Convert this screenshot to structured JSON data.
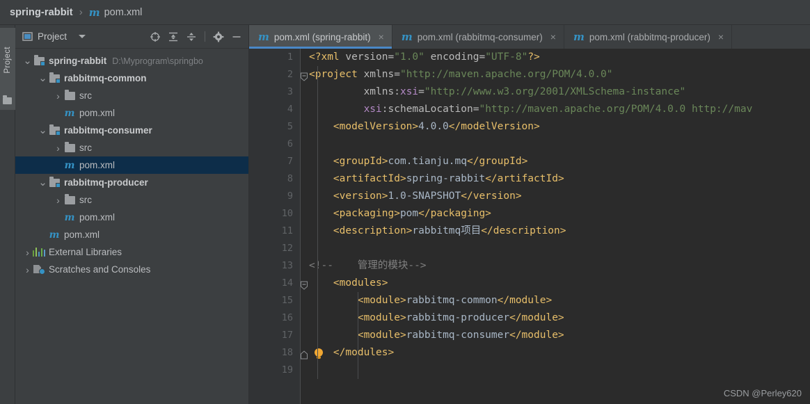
{
  "window": {
    "theme_bg": "#3c3f41",
    "editor_bg": "#2b2b2b",
    "accent": "#4a88c7",
    "selection_bg": "#0d2d49"
  },
  "breadcrumb": {
    "root": "spring-rabbit",
    "separator": "›",
    "file_icon": "m",
    "file": "pom.xml"
  },
  "tool_strip": {
    "project_tab_label": "Project",
    "folder_icon": "folder-icon"
  },
  "project_panel": {
    "title": "Project",
    "view_icon": "project-view-icon",
    "dropdown_icon": "chevron-down-icon",
    "toolbar_buttons": [
      {
        "name": "select-opened-file-icon",
        "label": "Select Opened File"
      },
      {
        "name": "expand-all-icon",
        "label": "Expand All"
      },
      {
        "name": "collapse-all-icon",
        "label": "Collapse All"
      },
      {
        "name": "gear-icon",
        "label": "Settings"
      },
      {
        "name": "hide-icon",
        "label": "Hide"
      }
    ],
    "tree": [
      {
        "label": "spring-rabbit",
        "path": "D:\\Myprogram\\springbo",
        "icon": "module-folder-icon",
        "arrow": "expanded",
        "indent": 0,
        "bold": true,
        "selected": false
      },
      {
        "label": "rabbitmq-common",
        "path": "",
        "icon": "module-folder-icon",
        "arrow": "expanded",
        "indent": 1,
        "bold": true,
        "selected": false
      },
      {
        "label": "src",
        "path": "",
        "icon": "folder-icon",
        "arrow": "collapsed",
        "indent": 2,
        "bold": false,
        "selected": false
      },
      {
        "label": "pom.xml",
        "path": "",
        "icon": "maven-file-icon",
        "arrow": "none",
        "indent": 2,
        "bold": false,
        "selected": false
      },
      {
        "label": "rabbitmq-consumer",
        "path": "",
        "icon": "module-folder-icon",
        "arrow": "expanded",
        "indent": 1,
        "bold": true,
        "selected": false
      },
      {
        "label": "src",
        "path": "",
        "icon": "folder-icon",
        "arrow": "collapsed",
        "indent": 2,
        "bold": false,
        "selected": false
      },
      {
        "label": "pom.xml",
        "path": "",
        "icon": "maven-file-icon",
        "arrow": "none",
        "indent": 2,
        "bold": false,
        "selected": true
      },
      {
        "label": "rabbitmq-producer",
        "path": "",
        "icon": "module-folder-icon",
        "arrow": "expanded",
        "indent": 1,
        "bold": true,
        "selected": false
      },
      {
        "label": "src",
        "path": "",
        "icon": "folder-icon",
        "arrow": "collapsed",
        "indent": 2,
        "bold": false,
        "selected": false
      },
      {
        "label": "pom.xml",
        "path": "",
        "icon": "maven-file-icon",
        "arrow": "none",
        "indent": 2,
        "bold": false,
        "selected": false
      },
      {
        "label": "pom.xml",
        "path": "",
        "icon": "maven-file-icon",
        "arrow": "none",
        "indent": 1,
        "bold": false,
        "selected": false
      },
      {
        "label": "External Libraries",
        "path": "",
        "icon": "library-icon",
        "arrow": "collapsed",
        "indent": 0,
        "bold": false,
        "selected": false
      },
      {
        "label": "Scratches and Consoles",
        "path": "",
        "icon": "scratches-icon",
        "arrow": "collapsed",
        "indent": 0,
        "bold": false,
        "selected": false
      }
    ]
  },
  "editor": {
    "tabs": [
      {
        "icon": "m",
        "label": "pom.xml (spring-rabbit)",
        "close": "×",
        "active": true
      },
      {
        "icon": "m",
        "label": "pom.xml (rabbitmq-consumer)",
        "close": "×",
        "active": false
      },
      {
        "icon": "m",
        "label": "pom.xml (rabbitmq-producer)",
        "close": "×",
        "active": false
      }
    ],
    "line_numbers": [
      "1",
      "2",
      "3",
      "4",
      "5",
      "6",
      "7",
      "8",
      "9",
      "10",
      "11",
      "12",
      "13",
      "14",
      "15",
      "16",
      "17",
      "18",
      "19"
    ],
    "lines": [
      {
        "n": 1,
        "fold": "none",
        "bulb": false,
        "tokens": [
          {
            "t": "tag",
            "s": "<?xml "
          },
          {
            "t": "attr",
            "s": "version="
          },
          {
            "t": "val",
            "s": "\"1.0\""
          },
          {
            "t": "attr",
            "s": " encoding="
          },
          {
            "t": "val",
            "s": "\"UTF-8\""
          },
          {
            "t": "tag",
            "s": "?>"
          }
        ]
      },
      {
        "n": 2,
        "fold": "open",
        "bulb": false,
        "tokens": [
          {
            "t": "tag",
            "s": "<project "
          },
          {
            "t": "attr",
            "s": "xmlns="
          },
          {
            "t": "val",
            "s": "\"http://maven.apache.org/POM/4.0.0\""
          }
        ]
      },
      {
        "n": 3,
        "fold": "none",
        "bulb": false,
        "tokens": [
          {
            "t": "txt",
            "s": "         "
          },
          {
            "t": "attr",
            "s": "xmlns:"
          },
          {
            "t": "ns",
            "s": "xsi"
          },
          {
            "t": "attr",
            "s": "="
          },
          {
            "t": "val",
            "s": "\"http://www.w3.org/2001/XMLSchema-instance\""
          }
        ]
      },
      {
        "n": 4,
        "fold": "none",
        "bulb": false,
        "tokens": [
          {
            "t": "txt",
            "s": "         "
          },
          {
            "t": "ns",
            "s": "xsi"
          },
          {
            "t": "attr",
            "s": ":schemaLocation="
          },
          {
            "t": "val",
            "s": "\"http://maven.apache.org/POM/4.0.0 http://mav"
          }
        ]
      },
      {
        "n": 5,
        "fold": "none",
        "bulb": false,
        "tokens": [
          {
            "t": "txt",
            "s": "    "
          },
          {
            "t": "tag",
            "s": "<modelVersion>"
          },
          {
            "t": "txt",
            "s": "4.0.0"
          },
          {
            "t": "tag",
            "s": "</modelVersion>"
          }
        ]
      },
      {
        "n": 6,
        "fold": "none",
        "bulb": false,
        "tokens": []
      },
      {
        "n": 7,
        "fold": "none",
        "bulb": false,
        "tokens": [
          {
            "t": "txt",
            "s": "    "
          },
          {
            "t": "tag",
            "s": "<groupId>"
          },
          {
            "t": "txt",
            "s": "com.tianju.mq"
          },
          {
            "t": "tag",
            "s": "</groupId>"
          }
        ]
      },
      {
        "n": 8,
        "fold": "none",
        "bulb": false,
        "tokens": [
          {
            "t": "txt",
            "s": "    "
          },
          {
            "t": "tag",
            "s": "<artifactId>"
          },
          {
            "t": "txt",
            "s": "spring-rabbit"
          },
          {
            "t": "tag",
            "s": "</artifactId>"
          }
        ]
      },
      {
        "n": 9,
        "fold": "none",
        "bulb": false,
        "tokens": [
          {
            "t": "txt",
            "s": "    "
          },
          {
            "t": "tag",
            "s": "<version>"
          },
          {
            "t": "txt",
            "s": "1.0-SNAPSHOT"
          },
          {
            "t": "tag",
            "s": "</version>"
          }
        ]
      },
      {
        "n": 10,
        "fold": "none",
        "bulb": false,
        "tokens": [
          {
            "t": "txt",
            "s": "    "
          },
          {
            "t": "tag",
            "s": "<packaging>"
          },
          {
            "t": "txt",
            "s": "pom"
          },
          {
            "t": "tag",
            "s": "</packaging>"
          }
        ]
      },
      {
        "n": 11,
        "fold": "none",
        "bulb": false,
        "tokens": [
          {
            "t": "txt",
            "s": "    "
          },
          {
            "t": "tag",
            "s": "<description>"
          },
          {
            "t": "txt",
            "s": "rabbitmq项目"
          },
          {
            "t": "tag",
            "s": "</description>"
          }
        ]
      },
      {
        "n": 12,
        "fold": "none",
        "bulb": false,
        "tokens": []
      },
      {
        "n": 13,
        "fold": "none",
        "bulb": false,
        "tokens": [
          {
            "t": "cmt",
            "s": "<!--    管理的模块-->"
          }
        ]
      },
      {
        "n": 14,
        "fold": "open",
        "bulb": false,
        "tokens": [
          {
            "t": "txt",
            "s": "    "
          },
          {
            "t": "tag",
            "s": "<modules>"
          }
        ]
      },
      {
        "n": 15,
        "fold": "none",
        "bulb": false,
        "tokens": [
          {
            "t": "txt",
            "s": "        "
          },
          {
            "t": "tag",
            "s": "<module>"
          },
          {
            "t": "txt",
            "s": "rabbitmq-common"
          },
          {
            "t": "tag",
            "s": "</module>"
          }
        ]
      },
      {
        "n": 16,
        "fold": "none",
        "bulb": false,
        "tokens": [
          {
            "t": "txt",
            "s": "        "
          },
          {
            "t": "tag",
            "s": "<module>"
          },
          {
            "t": "txt",
            "s": "rabbitmq-producer"
          },
          {
            "t": "tag",
            "s": "</module>"
          }
        ]
      },
      {
        "n": 17,
        "fold": "none",
        "bulb": false,
        "tokens": [
          {
            "t": "txt",
            "s": "        "
          },
          {
            "t": "tag",
            "s": "<module>"
          },
          {
            "t": "txt",
            "s": "rabbitmq-consumer"
          },
          {
            "t": "tag",
            "s": "</module>"
          }
        ]
      },
      {
        "n": 18,
        "fold": "close",
        "bulb": true,
        "tokens": [
          {
            "t": "txt",
            "s": "    "
          },
          {
            "t": "tag",
            "s": "</modules>"
          }
        ]
      },
      {
        "n": 19,
        "fold": "none",
        "bulb": false,
        "tokens": []
      }
    ]
  },
  "watermark": "CSDN @Perley620"
}
